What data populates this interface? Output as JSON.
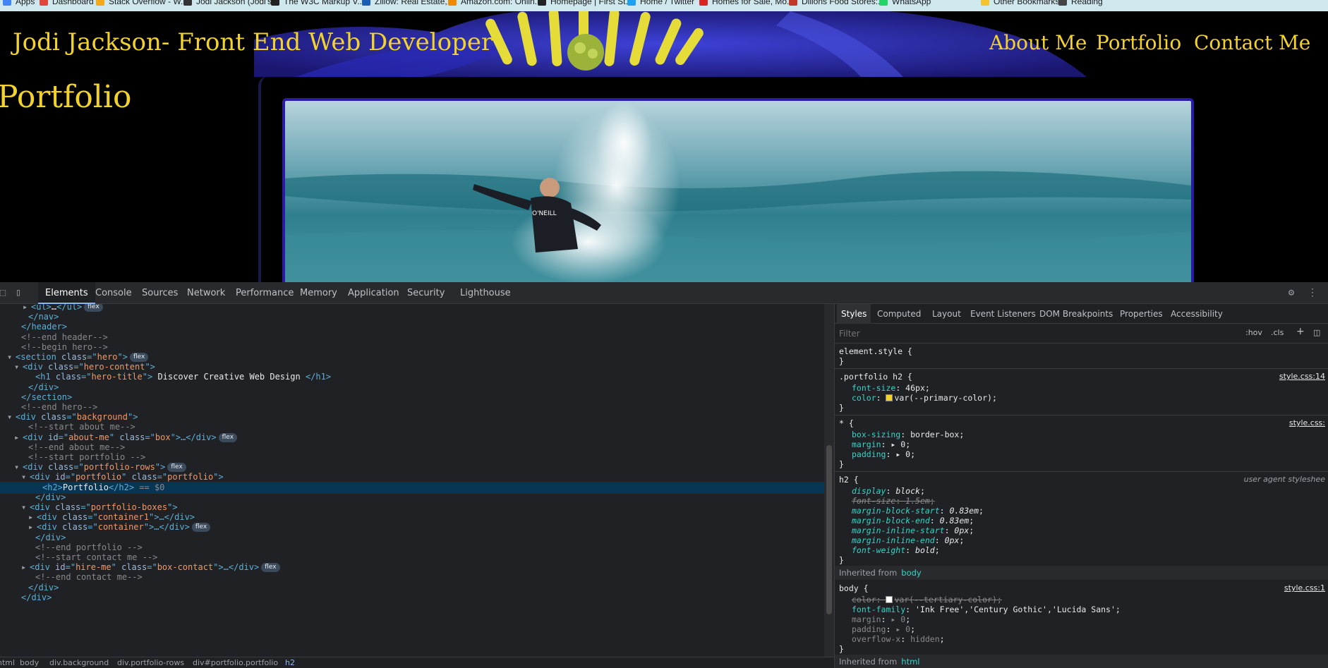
{
  "bookmarks": [
    "Apps",
    "Dashboard",
    "Stack Overflow - W...",
    "Jodi Jackson (Jodi's...",
    "The W3C Markup V...",
    "Zillow: Real Estate,...",
    "Amazon.com: Onlin...",
    "Homepage | First St...",
    "Home / Twitter",
    "Homes for Sale, Mo...",
    "Dillons Food Stores:...",
    "WhatsApp",
    "Other Bookmarks",
    "Reading"
  ],
  "page": {
    "site_title": "Jodi Jackson- Front End Web Developer",
    "nav": [
      "About Me",
      "Portfolio",
      "Contact Me"
    ],
    "portfolio_heading": "Portfolio",
    "photo_caption": "O'NEILL",
    "accent_color": "#f2d22d"
  },
  "devtools": {
    "tabs": [
      "Elements",
      "Console",
      "Sources",
      "Network",
      "Performance",
      "Memory",
      "Application",
      "Security",
      "Lighthouse"
    ],
    "dom": [
      {
        "tri": "▸",
        "pre": "<ul>",
        "mid": "…",
        "post": "</ul>",
        "badge": "flex"
      },
      {
        "tri": "",
        "pre": "</nav>"
      },
      {
        "tri": "",
        "pre": "</header>"
      },
      {
        "tri": "",
        "comment": "<!--end header-->"
      },
      {
        "tri": "",
        "comment": "<!--begin hero-->"
      },
      {
        "tri": "▾",
        "tag": "section",
        "attr": "class",
        "val": "hero",
        "badge": "flex"
      },
      {
        "tri": "▾",
        "tag": "div",
        "attr": "class",
        "val": "hero-content"
      },
      {
        "tri": "",
        "tag": "h1",
        "attr": "class",
        "val": "hero-title",
        "text": " Discover Creative Web Design ",
        "close": "</h1>"
      },
      {
        "tri": "",
        "pre": "</div>"
      },
      {
        "tri": "",
        "pre": "</section>"
      },
      {
        "tri": "",
        "comment": "<!--end hero-->"
      },
      {
        "tri": "▾",
        "tag": "div",
        "attr": "class",
        "val": "background"
      },
      {
        "tri": "",
        "comment": "<!--start about me-->"
      },
      {
        "tri": "▸",
        "tag": "div",
        "attr": "id",
        "val": "about-me",
        "attr2": "class",
        "val2": "box",
        "ell": "…</div>",
        "badge": "flex"
      },
      {
        "tri": "",
        "comment": "<!--end about me-->"
      },
      {
        "tri": "",
        "comment": "<!--start portfolio -->"
      },
      {
        "tri": "▾",
        "tag": "div",
        "attr": "class",
        "val": "portfolio-rows",
        "badge": "flex"
      },
      {
        "tri": "▾",
        "tag": "div",
        "attr": "id",
        "val": "portfolio",
        "attr2": "class",
        "val2": "portfolio"
      },
      {
        "tri": "",
        "selected": true,
        "pre": "<h2>",
        "text": "Portfolio",
        "close": "</h2>",
        "eq": " == $0"
      },
      {
        "tri": "",
        "pre": "</div>"
      },
      {
        "tri": "▾",
        "tag": "div",
        "attr": "class",
        "val": "portfolio-boxes"
      },
      {
        "tri": "▸",
        "tag": "div",
        "attr": "class",
        "val": "container1",
        "ell": "…</div>"
      },
      {
        "tri": "▸",
        "tag": "div",
        "attr": "class",
        "val": "container",
        "ell": "…</div>",
        "badge": "flex"
      },
      {
        "tri": "",
        "pre": "</div>"
      },
      {
        "tri": "",
        "comment": "<!--end portfolio -->"
      },
      {
        "tri": "",
        "comment": "<!--start contact me -->"
      },
      {
        "tri": "▸",
        "tag": "div",
        "attr": "id",
        "val": "hire-me",
        "attr2": "class",
        "val2": "box-contact",
        "ell": "…</div>",
        "badge": "flex"
      },
      {
        "tri": "",
        "comment": "<!--end contact me-->"
      },
      {
        "tri": "",
        "pre": "</div>"
      },
      {
        "tri": "",
        "pre": "</div>"
      }
    ],
    "breadcrumbs": [
      "html",
      "body",
      "div.background",
      "div.portfolio-rows",
      "div#portfolio.portfolio",
      "h2"
    ],
    "styles_tabs": [
      "Styles",
      "Computed",
      "Layout",
      "Event Listeners",
      "DOM Breakpoints",
      "Properties",
      "Accessibility"
    ],
    "filter_placeholder": "Filter",
    "filter_buttons": [
      ":hov",
      ".cls",
      "+"
    ],
    "rules": {
      "element_style": "element.style {",
      "r1_selector": ".portfolio h2 {",
      "r1_source": "style.css:14",
      "r1_props": [
        [
          "font-size",
          "46px"
        ],
        [
          "color",
          "var(--primary-color)"
        ]
      ],
      "r1_swatch": "#f2d22d",
      "r2_selector": "* {",
      "r2_source": "style.css:",
      "r2_props": [
        [
          "box-sizing",
          "border-box"
        ],
        [
          "margin",
          "▸ 0"
        ],
        [
          "padding",
          "▸ 0"
        ]
      ],
      "r3_selector": "h2 {",
      "r3_source": "user agent styleshee",
      "r3_props": [
        [
          "display",
          "block"
        ],
        [
          "font-size",
          "1.5em"
        ],
        [
          "margin-block-start",
          "0.83em"
        ],
        [
          "margin-block-end",
          "0.83em"
        ],
        [
          "margin-inline-start",
          "0px"
        ],
        [
          "margin-inline-end",
          "0px"
        ],
        [
          "font-weight",
          "bold"
        ]
      ],
      "inherited_label": "Inherited from",
      "inherited_body": "body",
      "r4_selector": "body {",
      "r4_source": "style.css:1",
      "r4_props": [
        [
          "color",
          "var(--tertiary-color)"
        ],
        [
          "font-family",
          "'Ink Free','Century Gothic','Lucida Sans'"
        ],
        [
          "margin",
          "▸ 0"
        ],
        [
          "padding",
          "▸ 0"
        ],
        [
          "overflow-x",
          "hidden"
        ]
      ],
      "r4_swatch": "#ffffff",
      "inherited_html": "html"
    }
  }
}
